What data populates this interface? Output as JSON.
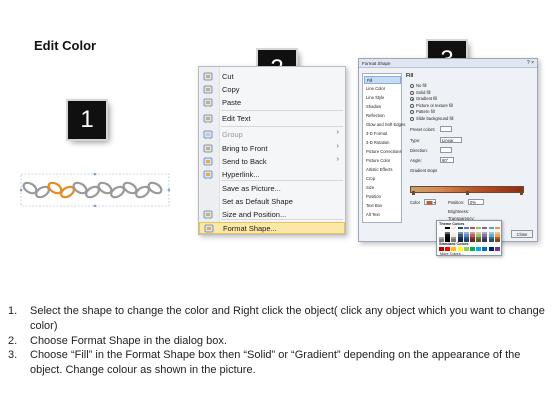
{
  "page": {
    "title": "Edit Color"
  },
  "badges": [
    "1",
    "2",
    "3"
  ],
  "context_menu": {
    "items": [
      {
        "label": "Cut",
        "icon": "scissors-icon"
      },
      {
        "label": "Copy",
        "icon": "copy-icon"
      },
      {
        "label": "Paste",
        "icon": "paste-icon"
      },
      {
        "label": "Edit Text",
        "icon": "edit-text-icon"
      },
      {
        "label": "Group",
        "icon": "group-icon",
        "disabled": true,
        "submenu": true
      },
      {
        "label": "Bring to Front",
        "icon": "bring-to-front-icon",
        "submenu": true
      },
      {
        "label": "Send to Back",
        "icon": "send-to-back-icon",
        "submenu": true
      },
      {
        "label": "Hyperlink...",
        "icon": "hyperlink-icon"
      },
      {
        "label": "Save as Picture...",
        "icon": ""
      },
      {
        "label": "Set as Default Shape",
        "icon": ""
      },
      {
        "label": "Size and Position...",
        "icon": "size-position-icon"
      },
      {
        "label": "Format Shape...",
        "icon": "format-shape-icon",
        "highlighted": true
      }
    ]
  },
  "dialog": {
    "title": "Format Shape",
    "close": "? ×",
    "nav": [
      "Fill",
      "Line Color",
      "Line Style",
      "Shadow",
      "Reflection",
      "Glow and Soft Edges",
      "3-D Format",
      "3-D Rotation",
      "Picture Corrections",
      "Picture Color",
      "Artistic Effects",
      "Crop",
      "Size",
      "Position",
      "Text Box",
      "Alt Text"
    ],
    "section": "Fill",
    "fill_options": [
      {
        "label": "No fill",
        "checked": false
      },
      {
        "label": "Solid fill",
        "checked": false
      },
      {
        "label": "Gradient fill",
        "checked": true
      },
      {
        "label": "Picture or texture fill",
        "checked": false
      },
      {
        "label": "Pattern fill",
        "checked": false
      },
      {
        "label": "Slide background fill",
        "checked": false
      }
    ],
    "fields": [
      {
        "label": "Preset colors:",
        "value": ""
      },
      {
        "label": "Type:",
        "value": "Linear"
      },
      {
        "label": "Direction:",
        "value": ""
      },
      {
        "label": "Angle:",
        "value": "90°"
      },
      {
        "label": "Gradient stops",
        "value": ""
      }
    ],
    "color_label": "Color",
    "position_label": "Position:",
    "position_value": "0%",
    "brightness_label": "Brightness:",
    "transparency_label": "Transparency:",
    "rotate_label": "Rotate with shape",
    "close_button": "Close"
  },
  "palette": {
    "theme_title": "Theme Colors",
    "standard_title": "Standard Colors",
    "more": "More Colors...",
    "theme_top": [
      "#ffffff",
      "#000000",
      "#eeece1",
      "#1f497d",
      "#4f81bd",
      "#c0504d",
      "#9bbb59",
      "#8064a2",
      "#4bacc6",
      "#f79646"
    ],
    "standard": [
      "#c00000",
      "#ff0000",
      "#ffc000",
      "#ffff00",
      "#92d050",
      "#00b050",
      "#00b0f0",
      "#0070c0",
      "#002060",
      "#7030a0"
    ]
  },
  "instructions": [
    {
      "num": "1.",
      "text": "Select the shape to change the color and Right click the object( click any object which you want to change color)"
    },
    {
      "num": "2.",
      "text": "Choose Format Shape in the dialog box."
    },
    {
      "num": "3.",
      "text": "Choose “Fill” in the Format Shape box then “Solid” or “Gradient” depending on the appearance of the object. Change colour as shown in the picture."
    }
  ]
}
